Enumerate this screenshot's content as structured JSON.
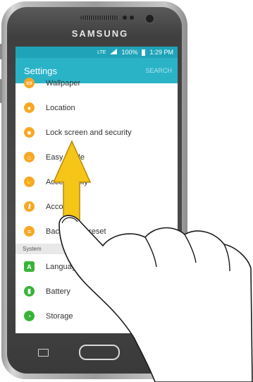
{
  "device": {
    "brand": "SAMSUNG"
  },
  "status_bar": {
    "network": "LTE",
    "battery": "100%",
    "time": "1:29 PM"
  },
  "app_bar": {
    "title": "Settings",
    "search": "SEARCH"
  },
  "settings_items": [
    {
      "label": "Wallpaper",
      "icon": "wallpaper-icon",
      "color": "#f7a823"
    },
    {
      "label": "Location",
      "icon": "location-icon",
      "color": "#f7a823"
    },
    {
      "label": "Lock screen and security",
      "icon": "lock-icon",
      "color": "#f7a823"
    },
    {
      "label": "Easy mode",
      "icon": "home-icon",
      "color": "#f7a823"
    },
    {
      "label": "Accessibility",
      "icon": "hand-icon",
      "color": "#f7a823"
    },
    {
      "label": "Accounts",
      "icon": "key-icon",
      "color": "#f7a823"
    },
    {
      "label": "Backup and reset",
      "icon": "backup-icon",
      "color": "#f7a823"
    }
  ],
  "system_section": {
    "header": "System"
  },
  "system_items": [
    {
      "label": "Language and input",
      "icon": "language-icon",
      "color": "#38b33a"
    },
    {
      "label": "Battery",
      "icon": "battery-icon",
      "color": "#38b33a"
    },
    {
      "label": "Storage",
      "icon": "storage-icon",
      "color": "#38b33a"
    }
  ],
  "gesture": {
    "direction": "swipe-up",
    "arrow_color": "#f5c518"
  }
}
